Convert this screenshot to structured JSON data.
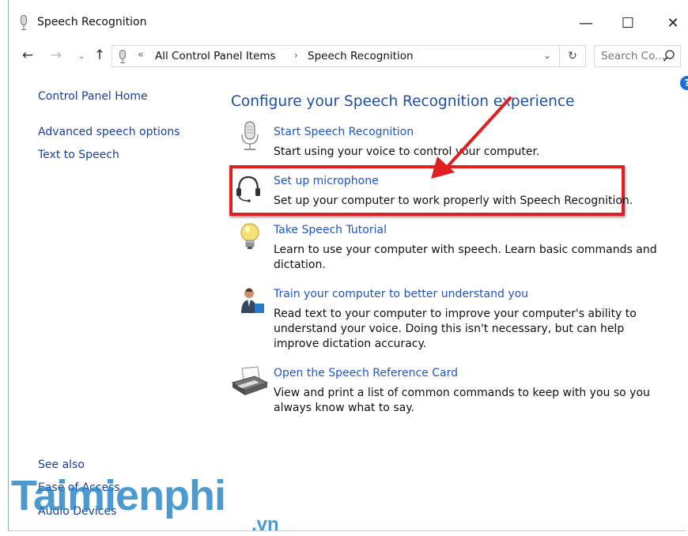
{
  "window": {
    "title": "Speech Recognition",
    "controls": {
      "minimize": "—",
      "maximize": "☐",
      "close": "✕"
    }
  },
  "address_bar": {
    "back": "←",
    "forward": "→",
    "recent": "⌄",
    "up": "↑",
    "chevron": "«",
    "breadcrumbs": [
      "All Control Panel Items",
      "Speech Recognition"
    ],
    "separator": "›",
    "dropdown": "⌄",
    "refresh": "↻"
  },
  "search": {
    "placeholder": "Search Co..."
  },
  "help": "?",
  "sidebar": {
    "home": "Control Panel Home",
    "items": [
      "Advanced speech options",
      "Text to Speech"
    ],
    "see_also": "See also",
    "see_also_items": [
      "Ease of Access",
      "Audio Devices"
    ]
  },
  "main": {
    "heading": "Configure your Speech Recognition experience",
    "items": [
      {
        "link": "Start Speech Recognition",
        "desc": "Start using your voice to control your computer.",
        "icon": "microphone-icon"
      },
      {
        "link": "Set up microphone",
        "desc": "Set up your computer to work properly with Speech Recognition.",
        "icon": "headset-icon"
      },
      {
        "link": "Take Speech Tutorial",
        "desc": "Learn to use your computer with speech.  Learn basic commands and dictation.",
        "icon": "lightbulb-icon"
      },
      {
        "link": "Train your computer to better understand you",
        "desc": "Read text to your computer to improve your computer's ability to understand your voice.  Doing this isn't necessary, but can help improve dictation accuracy.",
        "icon": "person-icon"
      },
      {
        "link": "Open the Speech Reference Card",
        "desc": "View and print a list of common commands to keep with you so you always know what to say.",
        "icon": "printer-icon"
      }
    ]
  },
  "annotation": {
    "highlight_color": "#e02020",
    "arrow_color": "#e02020"
  },
  "watermark": {
    "text": "Taimienphi",
    "suffix": ".vn"
  }
}
